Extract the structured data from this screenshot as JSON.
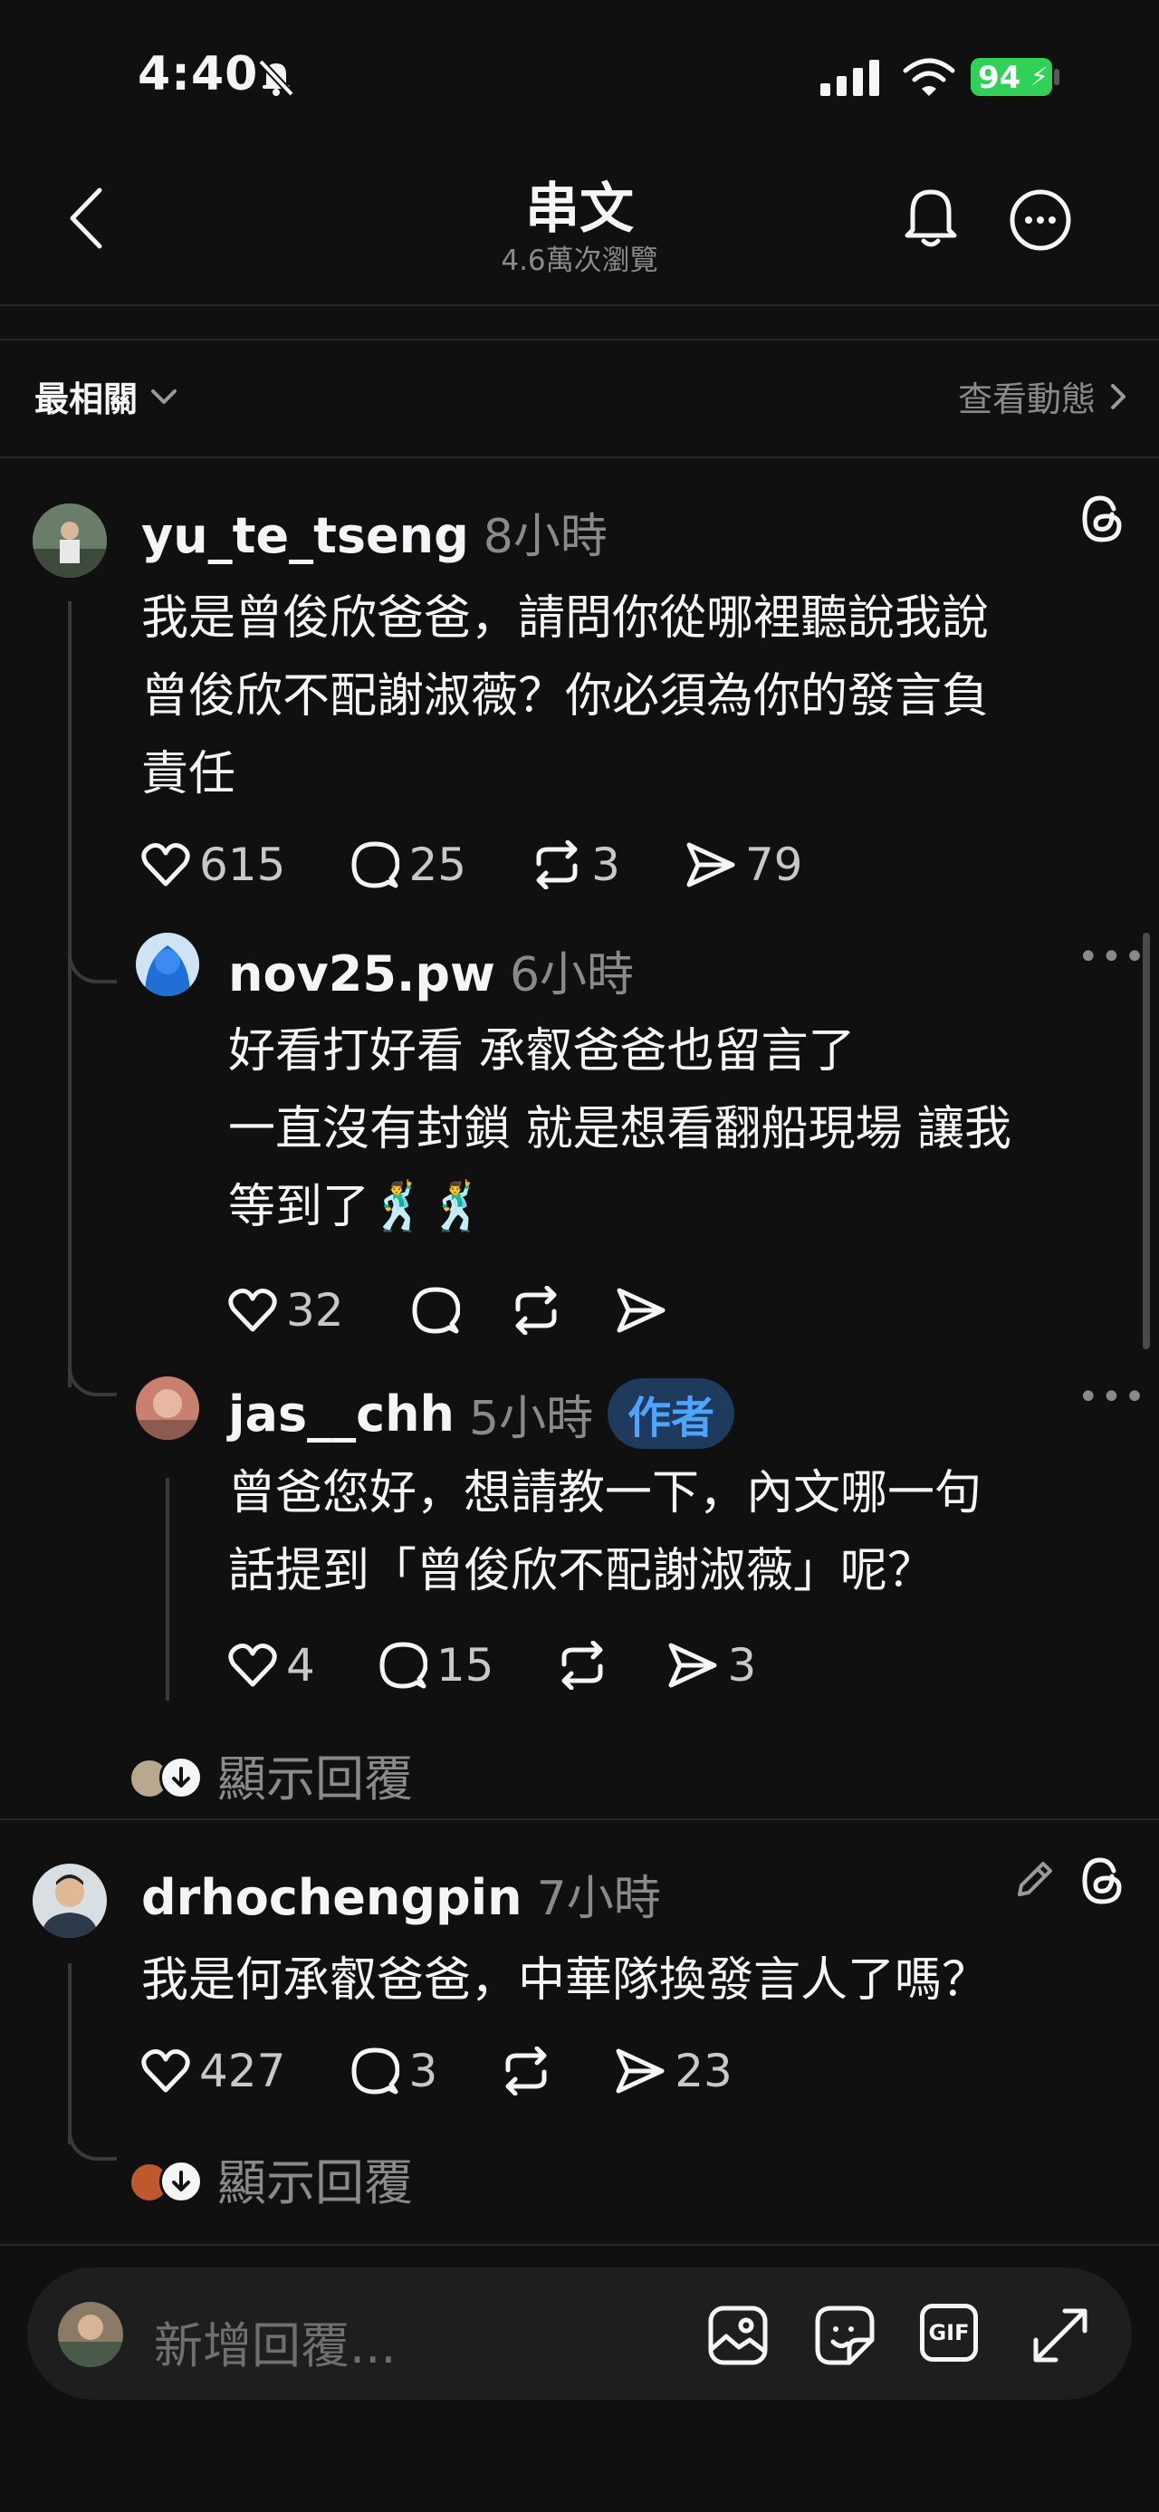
{
  "status_bar": {
    "time": "4:40",
    "battery": "94"
  },
  "header": {
    "title": "串文",
    "subtitle": "4.6萬次瀏覽"
  },
  "sort": {
    "label": "最相關",
    "activity_link": "查看動態"
  },
  "comments": [
    {
      "username": "yu_te_tseng",
      "time": "8小時",
      "lines": [
        "我是曾俊欣爸爸，請問你從哪裡聽說我說",
        "曾俊欣不配謝淑薇？你必須為你的發言負",
        "責任"
      ],
      "likes": "615",
      "replies": "25",
      "reposts": "3",
      "shares": "79"
    },
    {
      "username": "nov25.pw",
      "time": "6小時",
      "lines": [
        "好看打好看 承叡爸爸也留言了",
        "一直沒有封鎖 就是想看翻船現場 讓我",
        "等到了🕺🕺"
      ],
      "likes": "32"
    },
    {
      "username": "jas__chh",
      "time": "5小時",
      "badge": "作者",
      "lines": [
        "曾爸您好，想請教一下，內文哪一句",
        "話提到「曾俊欣不配謝淑薇」呢？"
      ],
      "likes": "4",
      "replies": "15",
      "shares": "3"
    },
    {
      "username": "drhochengpin",
      "time": "7小時",
      "lines": [
        "我是何承叡爸爸，中華隊換發言人了嗎？"
      ],
      "likes": "427",
      "replies": "3",
      "shares": "23"
    }
  ],
  "show_replies_label": "顯示回覆",
  "reply_bar": {
    "placeholder": "新增回覆...",
    "gif_label": "GIF"
  },
  "colors": {
    "background": "#101010",
    "text": "#f3f5f7",
    "muted": "#8a8a8a",
    "badge_bg": "#1e3a5c",
    "badge_text": "#4ea3ff",
    "battery": "#30d158"
  }
}
